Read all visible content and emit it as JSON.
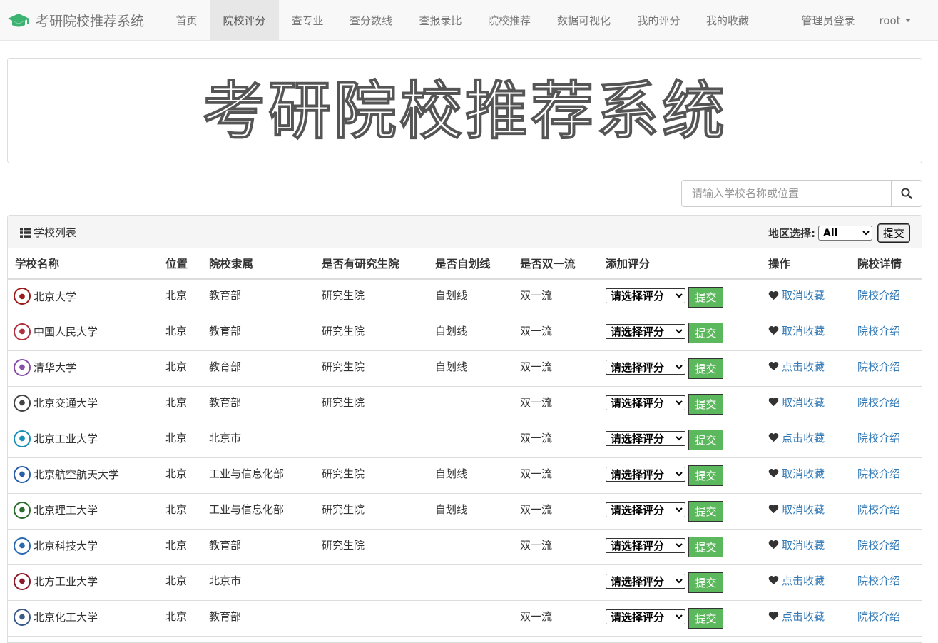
{
  "brand": {
    "title": "考研院校推荐系统",
    "icon": "graduation-cap-icon",
    "accent": "#3cb371"
  },
  "nav": {
    "items": [
      {
        "label": "首页"
      },
      {
        "label": "院校评分"
      },
      {
        "label": "查专业"
      },
      {
        "label": "查分数线"
      },
      {
        "label": "查报录比"
      },
      {
        "label": "院校推荐"
      },
      {
        "label": "数据可视化"
      },
      {
        "label": "我的评分"
      },
      {
        "label": "我的收藏"
      }
    ],
    "active": "院校评分",
    "admin_login": "管理员登录",
    "user": "root"
  },
  "banner": {
    "text": "考研院校推荐系统"
  },
  "search": {
    "placeholder": "请输入学校名称或位置",
    "icon": "search-icon"
  },
  "panel": {
    "title": "学校列表",
    "title_icon": "list-icon",
    "region_label": "地区选择:",
    "region_selected": "All",
    "region_submit": "提交"
  },
  "table": {
    "headers": [
      "学校名称",
      "位置",
      "院校隶属",
      "是否有研究生院",
      "是否自划线",
      "是否双一流",
      "添加评分",
      "操作",
      "院校详情"
    ],
    "rate_placeholder": "请选择评分",
    "rate_submit": "提交",
    "detail_label": "院校介绍",
    "rows": [
      {
        "name": "北京大学",
        "loc": "北京",
        "aff": "教育部",
        "grad": "研究生院",
        "self": "自划线",
        "dfc": "双一流",
        "fav": "取消收藏",
        "logo_color": "#9b1c1c"
      },
      {
        "name": "中国人民大学",
        "loc": "北京",
        "aff": "教育部",
        "grad": "研究生院",
        "self": "自划线",
        "dfc": "双一流",
        "fav": "取消收藏",
        "logo_color": "#b03040"
      },
      {
        "name": "清华大学",
        "loc": "北京",
        "aff": "教育部",
        "grad": "研究生院",
        "self": "自划线",
        "dfc": "双一流",
        "fav": "点击收藏",
        "logo_color": "#8a4fa8"
      },
      {
        "name": "北京交通大学",
        "loc": "北京",
        "aff": "教育部",
        "grad": "研究生院",
        "self": "",
        "dfc": "双一流",
        "fav": "取消收藏",
        "logo_color": "#444444"
      },
      {
        "name": "北京工业大学",
        "loc": "北京",
        "aff": "北京市",
        "grad": "",
        "self": "",
        "dfc": "双一流",
        "fav": "点击收藏",
        "logo_color": "#1a8fb8"
      },
      {
        "name": "北京航空航天大学",
        "loc": "北京",
        "aff": "工业与信息化部",
        "grad": "研究生院",
        "self": "自划线",
        "dfc": "双一流",
        "fav": "取消收藏",
        "logo_color": "#2a5ea8"
      },
      {
        "name": "北京理工大学",
        "loc": "北京",
        "aff": "工业与信息化部",
        "grad": "研究生院",
        "self": "自划线",
        "dfc": "双一流",
        "fav": "取消收藏",
        "logo_color": "#2e6b2e"
      },
      {
        "name": "北京科技大学",
        "loc": "北京",
        "aff": "教育部",
        "grad": "研究生院",
        "self": "",
        "dfc": "双一流",
        "fav": "取消收藏",
        "logo_color": "#2a6ab0"
      },
      {
        "name": "北方工业大学",
        "loc": "北京",
        "aff": "北京市",
        "grad": "",
        "self": "",
        "dfc": "",
        "fav": "点击收藏",
        "logo_color": "#8b1a2b"
      },
      {
        "name": "北京化工大学",
        "loc": "北京",
        "aff": "教育部",
        "grad": "",
        "self": "",
        "dfc": "双一流",
        "fav": "点击收藏",
        "logo_color": "#3a5a8a"
      }
    ]
  }
}
